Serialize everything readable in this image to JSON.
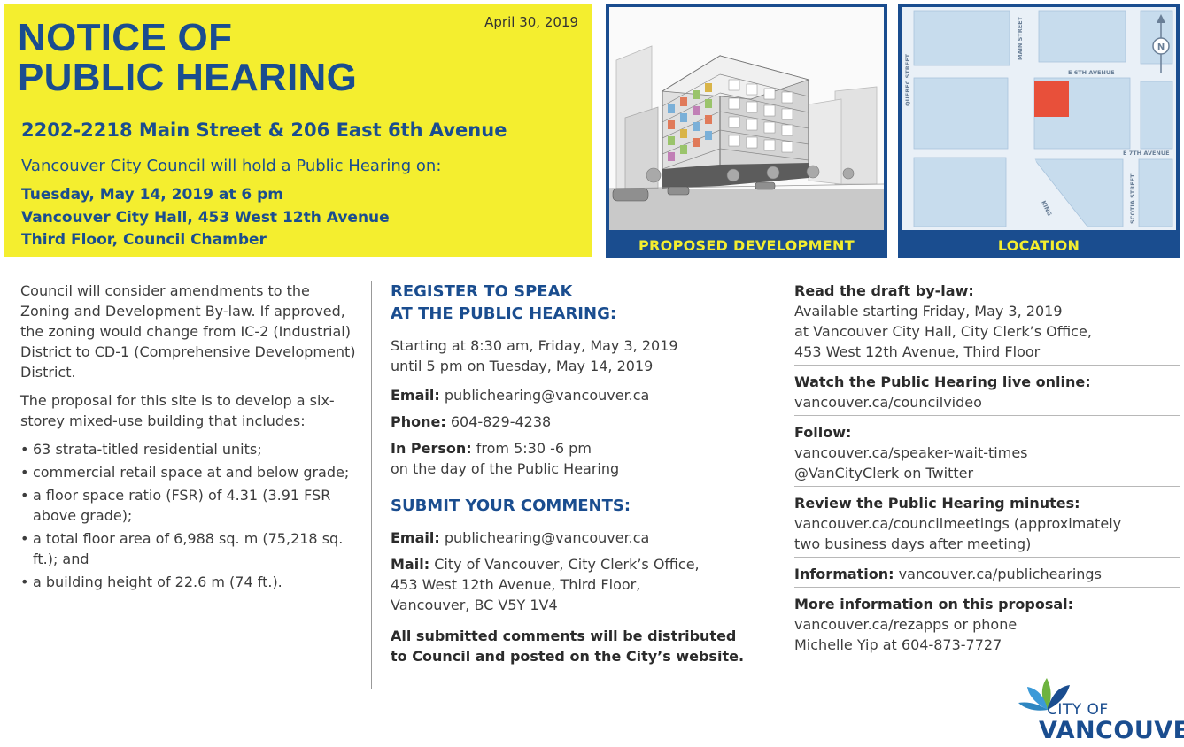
{
  "header": {
    "date": "April 30, 2019",
    "title_line1": "NOTICE OF",
    "title_line2": "PUBLIC HEARING",
    "address": "2202-2218 Main Street & 206 East 6th Avenue",
    "intro": "Vancouver City Council will hold a Public Hearing on:",
    "when": [
      "Tuesday, May 14, 2019 at 6 pm",
      "Vancouver City Hall, 453 West 12th Avenue",
      "Third Floor, Council Chamber"
    ]
  },
  "panels": {
    "development_caption": "PROPOSED DEVELOPMENT",
    "location_caption": "LOCATION",
    "map_labels": {
      "main_street": "MAIN STREET",
      "quebec_street": "QUEBEC STREET",
      "e6": "E 6TH AVENUE",
      "e7": "E 7TH AVENUE",
      "scotia": "SCOTIA STREET",
      "kingsway": "KING",
      "north": "N"
    }
  },
  "col1": {
    "p1": "Council will consider amendments to the Zoning and Development By-law. If approved, the zoning would change from IC-2 (Industrial) District to CD-1 (Comprehensive Development) District.",
    "p2": "The proposal for this site is to develop a six-storey mixed-use building that includes:",
    "bullets": [
      "63 strata-titled residential units;",
      "commercial retail space at and below grade;",
      "a floor space ratio (FSR) of 4.31 (3.91 FSR above grade);",
      "a total floor area of 6,988 sq. m (75,218 sq. ft.); and",
      "a building height of 22.6 m (74 ft.)."
    ]
  },
  "col2": {
    "register_h1": "REGISTER TO SPEAK",
    "register_h2": "AT THE PUBLIC HEARING:",
    "starting1": "Starting at 8:30 am, Friday, May 3, 2019",
    "starting2": "until 5 pm on Tuesday, May 14, 2019",
    "email_label": "Email:",
    "email": "publichearing@vancouver.ca",
    "phone_label": "Phone:",
    "phone": "604-829-4238",
    "inperson_label": "In Person:",
    "inperson": "from 5:30 -6 pm",
    "inperson2": "on the day of the Public Hearing",
    "submit_h": "SUBMIT YOUR COMMENTS:",
    "email2_label": "Email:",
    "email2": "publichearing@vancouver.ca",
    "mail_label": "Mail:",
    "mail1": "City of Vancouver, City Clerk’s Office,",
    "mail2": "453 West 12th Avenue, Third Floor,",
    "mail3": "Vancouver, BC  V5Y 1V4",
    "closing1": "All submitted comments will be distributed",
    "closing2": "to Council and posted on the City’s website."
  },
  "col3": {
    "draft_label": "Read the draft by-law:",
    "draft1": "Available starting Friday, May 3, 2019",
    "draft2": "at Vancouver City Hall, City Clerk’s Office,",
    "draft3": "453 West 12th Avenue, Third Floor",
    "watch_label": "Watch the Public Hearing live online:",
    "watch_link": "vancouver.ca/councilvideo",
    "follow_label": "Follow:",
    "follow1": "vancouver.ca/speaker-wait-times",
    "follow2": "@VanCityClerk on Twitter",
    "minutes_label": "Review the Public Hearing minutes:",
    "minutes1": "vancouver.ca/councilmeetings (approximately",
    "minutes2": "two business days after meeting)",
    "info_label": "Information:",
    "info_link": "vancouver.ca/publichearings",
    "more_label": "More information on this proposal:",
    "more1": "vancouver.ca/rezapps or phone",
    "more2": "Michelle Yip at 604-873-7727"
  },
  "logo": {
    "city": "CITY OF",
    "vancouver": "VANCOUVER"
  },
  "colors": {
    "brand_blue": "#1a4d8f",
    "yellow": "#f4ee2f",
    "site_red": "#e8503a",
    "logo_green": "#6db33f"
  }
}
